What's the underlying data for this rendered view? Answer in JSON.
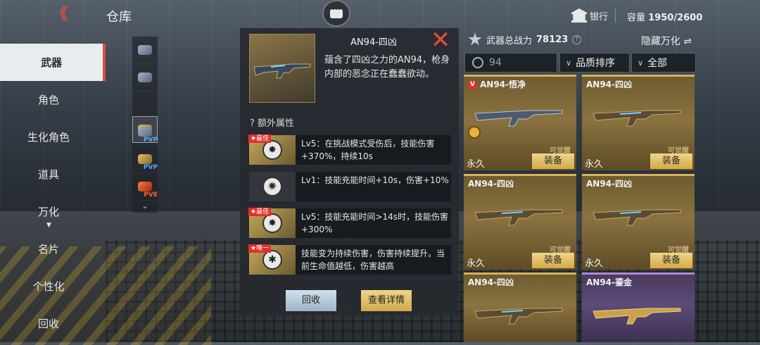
{
  "header": {
    "back_label": "《",
    "title": "仓库",
    "bank_label": "银行",
    "capacity_label": "容量",
    "capacity_value": "1950/2600"
  },
  "nav": [
    {
      "label": "武器",
      "active": true
    },
    {
      "label": "角色"
    },
    {
      "label": "生化角色"
    },
    {
      "label": "道具"
    },
    {
      "label": "万化",
      "sub": "▼"
    },
    {
      "label": "名片"
    },
    {
      "label": "个性化"
    },
    {
      "label": "回收"
    }
  ],
  "strip": {
    "tags": [
      "",
      "",
      "",
      "PVP",
      "PVP",
      "PVE"
    ],
    "more": "⌄"
  },
  "detail": {
    "name": "AN94-四凶",
    "close": "✕",
    "description": "蕴含了四凶之力的AN94，枪身内部的恶念正在蠢蠢欲动。",
    "extra_title": "? 额外属性",
    "attributes": [
      {
        "flag": "★最佳",
        "text": "Lv5：在挑战模式受伤后，技能伤害+370%，持续10s"
      },
      {
        "flag": "",
        "text": "Lv1：技能充能时间+10s，伤害+10%"
      },
      {
        "flag": "★最佳",
        "text": "Lv5：技能充能时间>14s时，技能伤害+300%"
      },
      {
        "flag": "★唯一",
        "text": "技能变为持续伤害，伤害持续提升。当前生命值越低，伤害越高"
      }
    ],
    "recycle_btn": "回收",
    "view_btn": "查看详情"
  },
  "right": {
    "power_label": "武器总战力",
    "power_value": "78123",
    "power_q": "?",
    "hide_label": "隐藏万化 ⇌",
    "search_value": "94",
    "sort_label": "品质排序",
    "filter_label": "全部",
    "cards": [
      {
        "name": "AN94-悟净",
        "vmark": "V",
        "awake": "可觉醒",
        "perm": "永久",
        "equip": "装备"
      },
      {
        "name": "AN94-四凶",
        "vmark": "",
        "awake": "可觉醒",
        "perm": "永久",
        "equip": "装备"
      },
      {
        "name": "AN94-四凶",
        "vmark": "",
        "awake": "可觉醒",
        "perm": "永久",
        "equip": "装备"
      },
      {
        "name": "AN94-四凶",
        "vmark": "",
        "awake": "可觉醒",
        "perm": "永久",
        "equip": "装备"
      },
      {
        "name": "AN94-四凶",
        "vmark": "",
        "awake": "",
        "perm": "",
        "equip": ""
      },
      {
        "name": "AN94-鎏金",
        "vmark": "",
        "awake": "",
        "perm": "",
        "equip": ""
      }
    ]
  },
  "colors": {
    "accent_red": "#e34b3c",
    "gold": "#d8b35b",
    "purple": "#b08ad8",
    "pvp_blue": "#5aa9ff",
    "pve_red": "#ff5a3a"
  }
}
